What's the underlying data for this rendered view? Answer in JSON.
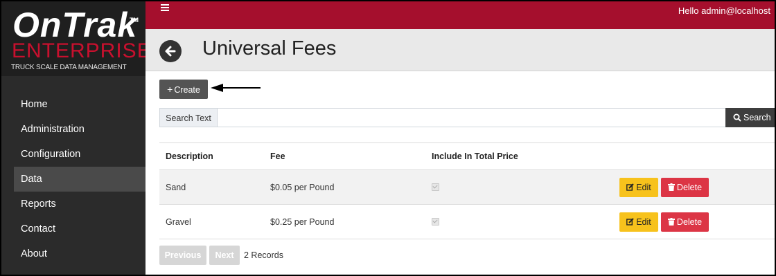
{
  "brand": {
    "word": "OnTrak",
    "tm": "TM",
    "enterprise": "ENTERPRISE",
    "tagline": "TRUCK SCALE DATA MANAGEMENT"
  },
  "sidebar": {
    "items": [
      {
        "label": "Home"
      },
      {
        "label": "Administration"
      },
      {
        "label": "Configuration"
      },
      {
        "label": "Data",
        "active": true
      },
      {
        "label": "Reports"
      },
      {
        "label": "Contact"
      },
      {
        "label": "About"
      }
    ]
  },
  "topbar": {
    "greeting": "Hello admin@localhost"
  },
  "page": {
    "title": "Universal Fees"
  },
  "toolbar": {
    "create_label": "Create"
  },
  "search": {
    "label": "Search Text",
    "value": "",
    "button_label": "Search"
  },
  "table": {
    "headers": [
      "Description",
      "Fee",
      "Include In Total Price"
    ],
    "rows": [
      {
        "description": "Sand",
        "fee": "$0.05 per Pound",
        "include": true
      },
      {
        "description": "Gravel",
        "fee": "$0.25 per Pound",
        "include": true
      }
    ],
    "edit_label": "Edit",
    "delete_label": "Delete"
  },
  "pagination": {
    "prev_label": "Previous",
    "next_label": "Next",
    "records": "2 Records"
  },
  "colors": {
    "topbar": "#a50f2d",
    "sidebar": "#2b2b2b",
    "edit": "#f7c21c",
    "delete": "#dc3545"
  }
}
